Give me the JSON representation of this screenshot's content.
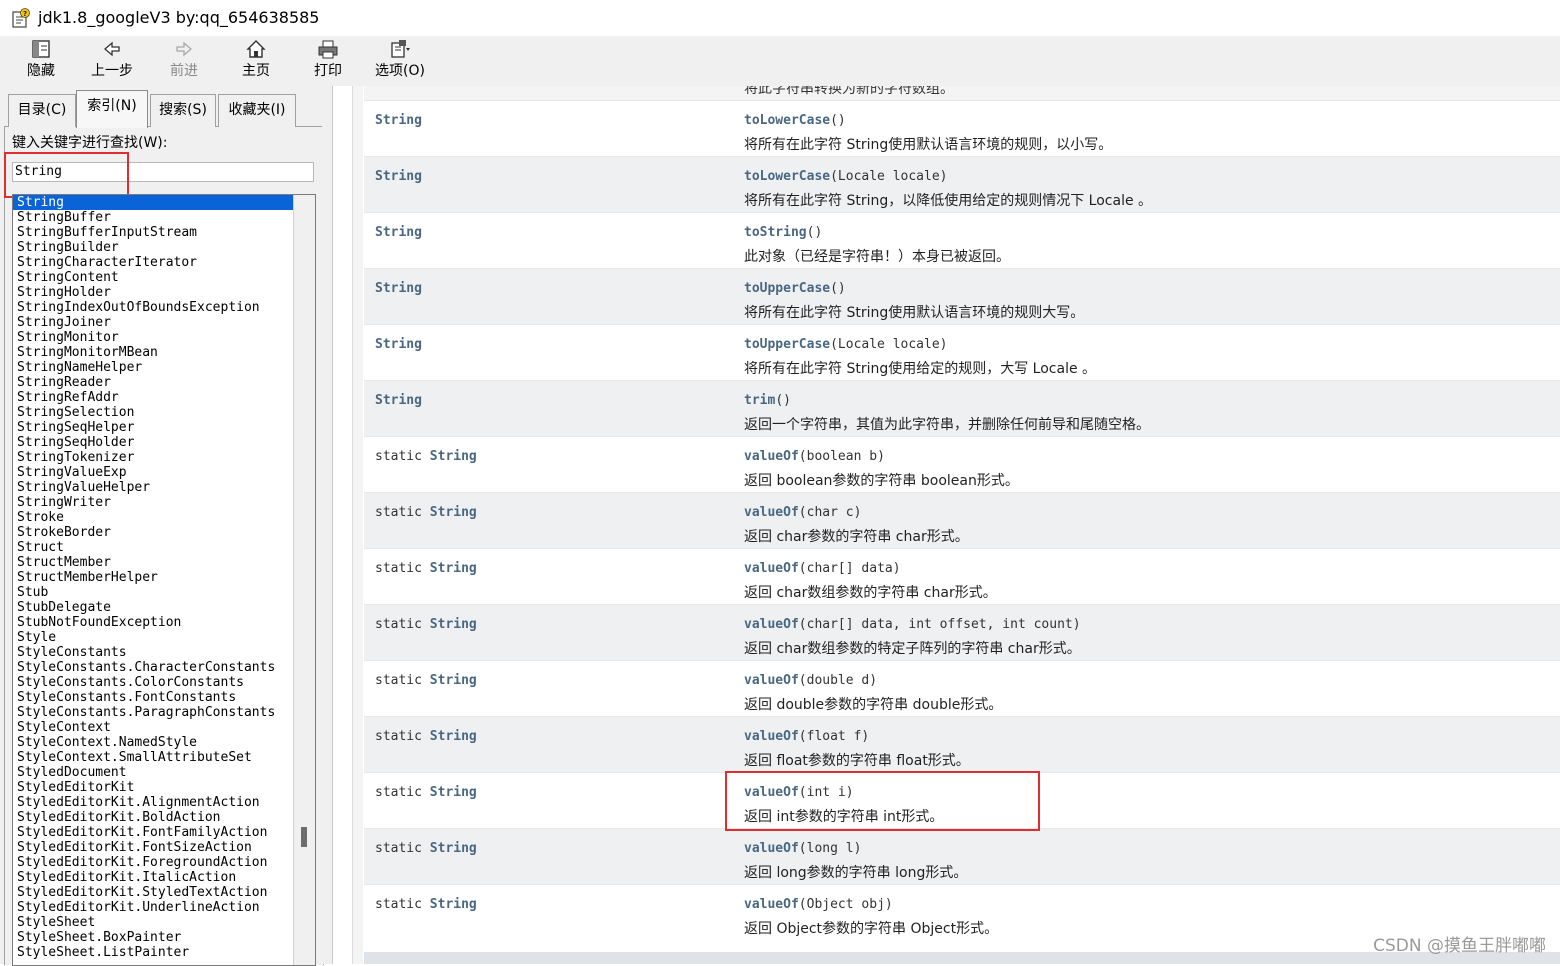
{
  "window": {
    "title": "jdk1.8_googleV3 by:qq_654638585"
  },
  "toolbar": {
    "buttons": [
      {
        "label": "隐藏",
        "icon": "hide-pane-icon",
        "enabled": true
      },
      {
        "label": "上一步",
        "icon": "back-arrow-icon",
        "enabled": true
      },
      {
        "label": "前进",
        "icon": "forward-arrow-icon",
        "enabled": false
      },
      {
        "label": "主页",
        "icon": "home-icon",
        "enabled": true
      },
      {
        "label": "打印",
        "icon": "print-icon",
        "enabled": true
      },
      {
        "label": "选项(O)",
        "icon": "options-icon",
        "enabled": true
      }
    ]
  },
  "left_pane": {
    "tabs": [
      {
        "label": "目录(C)",
        "active": false
      },
      {
        "label": "索引(N)",
        "active": true
      },
      {
        "label": "搜索(S)",
        "active": false
      },
      {
        "label": "收藏夹(I)",
        "active": false
      }
    ],
    "search_label": "键入关键字进行查找(W):",
    "search_value": "String",
    "index_items": [
      "String",
      "StringBuffer",
      "StringBufferInputStream",
      "StringBuilder",
      "StringCharacterIterator",
      "StringContent",
      "StringHolder",
      "StringIndexOutOfBoundsException",
      "StringJoiner",
      "StringMonitor",
      "StringMonitorMBean",
      "StringNameHelper",
      "StringReader",
      "StringRefAddr",
      "StringSelection",
      "StringSeqHelper",
      "StringSeqHolder",
      "StringTokenizer",
      "StringValueExp",
      "StringValueHelper",
      "StringWriter",
      "Stroke",
      "StrokeBorder",
      "Struct",
      "StructMember",
      "StructMemberHelper",
      "Stub",
      "StubDelegate",
      "StubNotFoundException",
      "Style",
      "StyleConstants",
      "StyleConstants.CharacterConstants",
      "StyleConstants.ColorConstants",
      "StyleConstants.FontConstants",
      "StyleConstants.ParagraphConstants",
      "StyleContext",
      "StyleContext.NamedStyle",
      "StyleContext.SmallAttributeSet",
      "StyledDocument",
      "StyledEditorKit",
      "StyledEditorKit.AlignmentAction",
      "StyledEditorKit.BoldAction",
      "StyledEditorKit.FontFamilyAction",
      "StyledEditorKit.FontSizeAction",
      "StyledEditorKit.ForegroundAction",
      "StyledEditorKit.ItalicAction",
      "StyledEditorKit.StyledTextAction",
      "StyledEditorKit.UnderlineAction",
      "StyleSheet",
      "StyleSheet.BoxPainter",
      "StyleSheet.ListPainter"
    ],
    "selected_index": 0
  },
  "content": {
    "cut_text": "将此字符串转换为新的字符数组。",
    "methods": [
      {
        "modifier": "",
        "type": "String",
        "name": "toLowerCase",
        "params": "()",
        "desc": "将所有在此字符 String使用默认语言环境的规则，以小写。"
      },
      {
        "modifier": "",
        "type": "String",
        "name": "toLowerCase",
        "params": "(Locale locale)",
        "desc": "将所有在此字符 String，以降低使用给定的规则情况下 Locale 。"
      },
      {
        "modifier": "",
        "type": "String",
        "name": "toString",
        "params": "()",
        "desc": "此对象（已经是字符串！）本身已被返回。"
      },
      {
        "modifier": "",
        "type": "String",
        "name": "toUpperCase",
        "params": "()",
        "desc": "将所有在此字符 String使用默认语言环境的规则大写。"
      },
      {
        "modifier": "",
        "type": "String",
        "name": "toUpperCase",
        "params": "(Locale locale)",
        "desc": "将所有在此字符 String使用给定的规则，大写 Locale 。"
      },
      {
        "modifier": "",
        "type": "String",
        "name": "trim",
        "params": "()",
        "desc": "返回一个字符串，其值为此字符串，并删除任何前导和尾随空格。"
      },
      {
        "modifier": "static ",
        "type": "String",
        "name": "valueOf",
        "params": "(boolean b)",
        "desc": "返回 boolean参数的字符串 boolean形式。"
      },
      {
        "modifier": "static ",
        "type": "String",
        "name": "valueOf",
        "params": "(char c)",
        "desc": "返回 char参数的字符串 char形式。"
      },
      {
        "modifier": "static ",
        "type": "String",
        "name": "valueOf",
        "params": "(char[] data)",
        "desc": "返回 char数组参数的字符串 char形式。"
      },
      {
        "modifier": "static ",
        "type": "String",
        "name": "valueOf",
        "params": "(char[] data, int offset, int count)",
        "desc": "返回 char数组参数的特定子阵列的字符串 char形式。"
      },
      {
        "modifier": "static ",
        "type": "String",
        "name": "valueOf",
        "params": "(double d)",
        "desc": "返回 double参数的字符串 double形式。"
      },
      {
        "modifier": "static ",
        "type": "String",
        "name": "valueOf",
        "params": "(float f)",
        "desc": "返回 float参数的字符串 float形式。"
      },
      {
        "modifier": "static ",
        "type": "String",
        "name": "valueOf",
        "params": "(int i)",
        "desc": "返回 int参数的字符串 int形式。"
      },
      {
        "modifier": "static ",
        "type": "String",
        "name": "valueOf",
        "params": "(long l)",
        "desc": "返回 long参数的字符串 long形式。"
      },
      {
        "modifier": "static ",
        "type": "String",
        "name": "valueOf",
        "params": "(Object obj)",
        "desc": "返回 Object参数的字符串 Object形式。"
      }
    ]
  },
  "watermark": "CSDN @摸鱼王胖嘟嘟",
  "colors": {
    "highlight_box": "#e02d2d",
    "selection": "#0a64d8",
    "code_link": "#4a6782"
  }
}
